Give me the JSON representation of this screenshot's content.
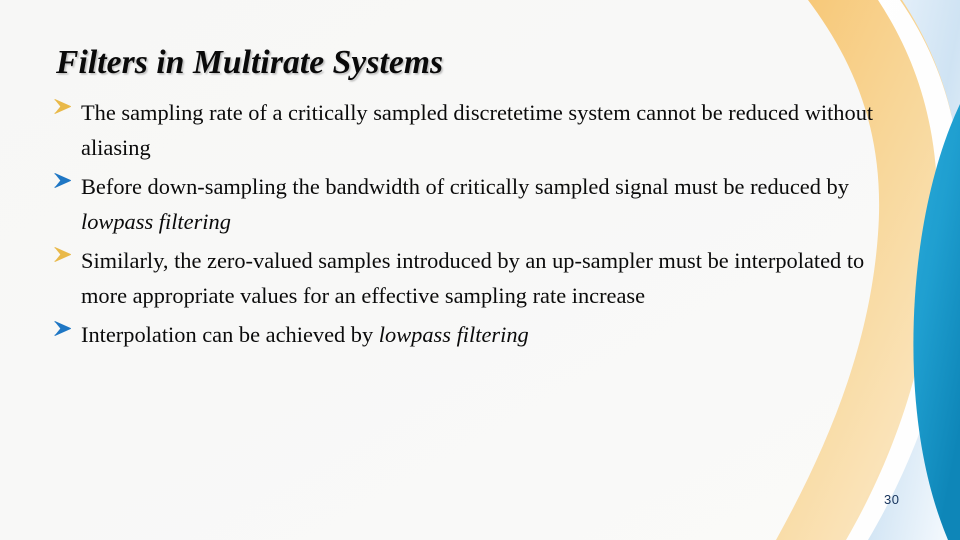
{
  "slide": {
    "title": "Filters in Multirate Systems",
    "slide_number": "30",
    "background_color": "#f8f8f7",
    "title_color": "#0a0a0a",
    "body_text_color": "#0b0b0b",
    "bullet_gold_color": "#e9b949",
    "bullet_blue_color": "#1f77c4",
    "accent_cyan_color": "#1f9fd0",
    "accent_amber_color": "#f5c97a",
    "accent_lightblue_color": "#dce9f7",
    "slide_number_color": "#16335c"
  },
  "bullets": [
    {
      "marker_icon": "arrowhead-bullet-icon",
      "marker_color": "#e9b949",
      "segments": [
        {
          "text": "The sampling rate of a critically sampled discretetime system cannot be reduced without aliasing",
          "italic": false
        }
      ]
    },
    {
      "marker_icon": "arrowhead-bullet-icon",
      "marker_color": "#1f77c4",
      "segments": [
        {
          "text": "Before down-sampling the bandwidth of critically sampled signal must be reduced by ",
          "italic": false
        },
        {
          "text": "lowpass filtering",
          "italic": true
        }
      ]
    },
    {
      "marker_icon": "arrowhead-bullet-icon",
      "marker_color": "#e9b949",
      "segments": [
        {
          "text": "Similarly, the zero-valued samples introduced by an up-sampler must be interpolated to more appropriate values for an effective sampling rate increase",
          "italic": false
        }
      ]
    },
    {
      "marker_icon": "arrowhead-bullet-icon",
      "marker_color": "#1f77c4",
      "segments": [
        {
          "text": "Interpolation can be achieved by ",
          "italic": false
        },
        {
          "text": "lowpass filtering",
          "italic": true
        }
      ]
    }
  ],
  "decoration": {
    "name": "right-edge-wave-ribbon",
    "layers": [
      {
        "name": "light-blue-outer-wash",
        "color": "#e3edf9"
      },
      {
        "name": "amber-ribbon",
        "color": "#f6cc86"
      },
      {
        "name": "light-blue-inner-band",
        "color": "#cfe3f3"
      },
      {
        "name": "cyan-teardrop",
        "color": "#1f9fd0"
      }
    ]
  }
}
